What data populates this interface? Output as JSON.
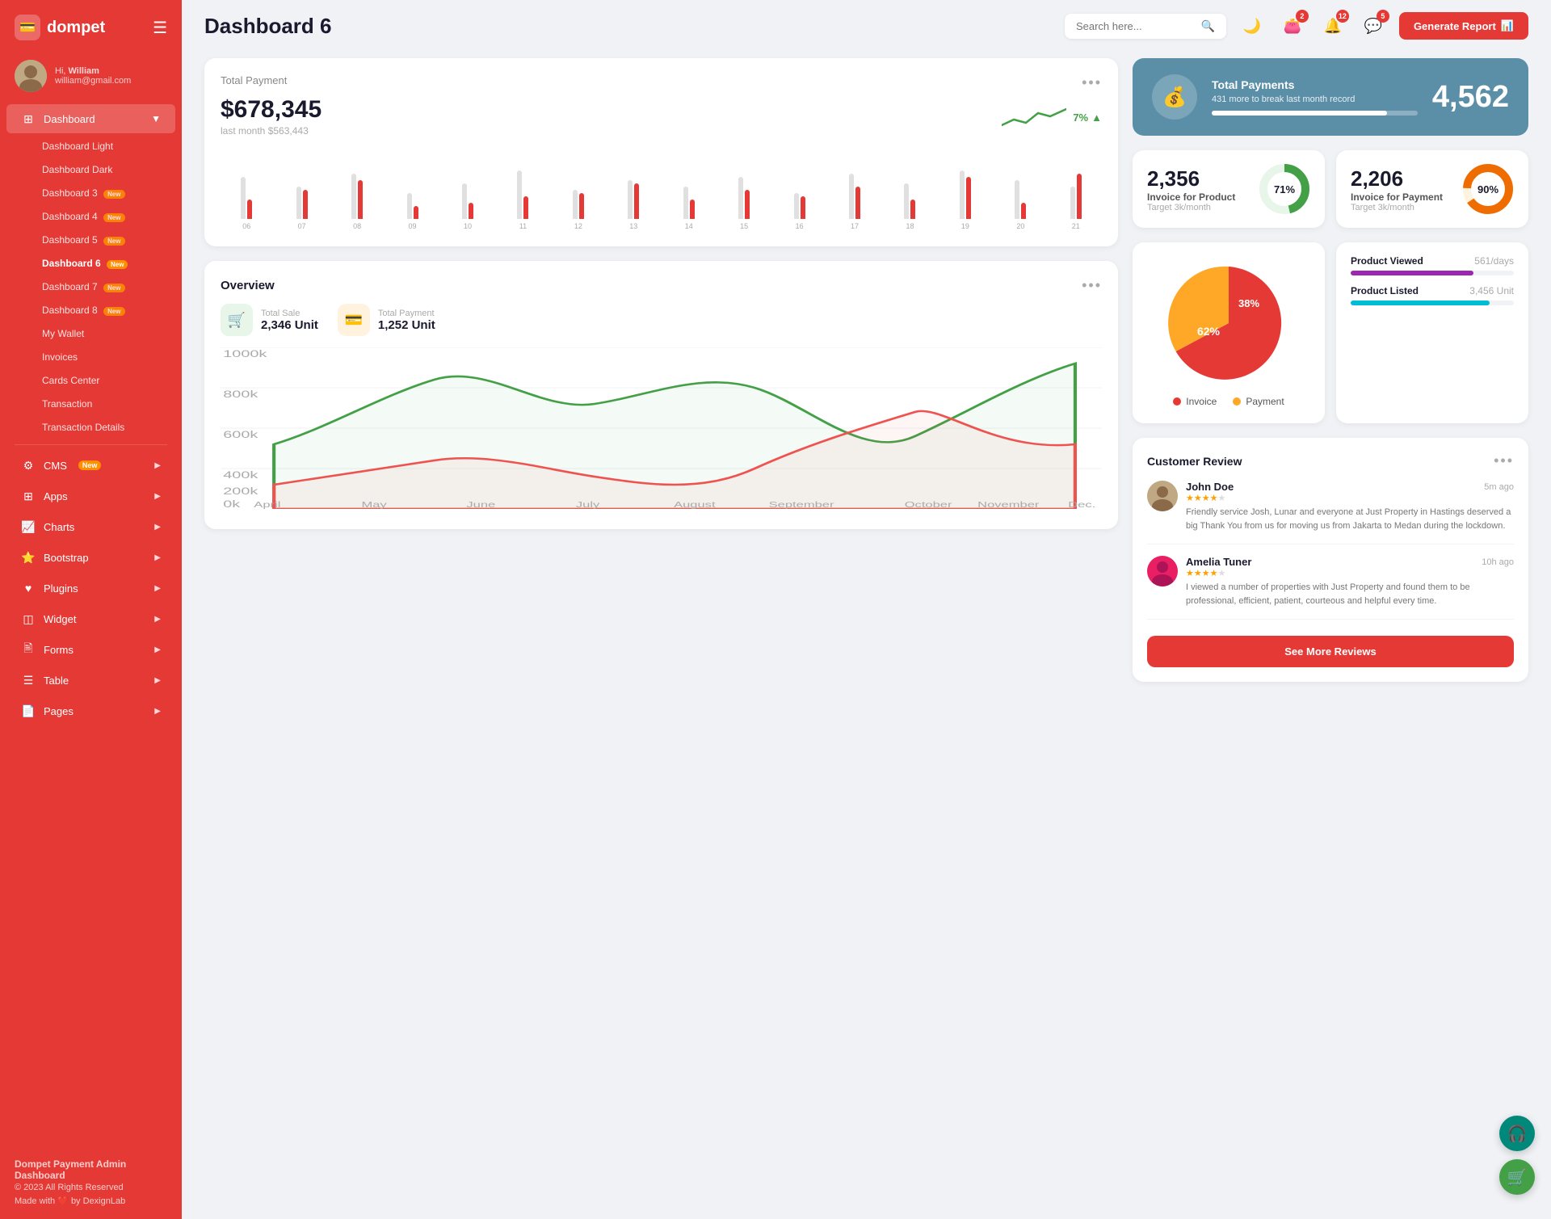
{
  "brand": {
    "name": "dompet",
    "logo_icon": "💳"
  },
  "user": {
    "greeting": "Hi,",
    "name": "William",
    "email": "william@gmail.com",
    "avatar_color": "#c0a882"
  },
  "page_title": "Dashboard 6",
  "search": {
    "placeholder": "Search here..."
  },
  "topbar": {
    "icons": {
      "dark_mode": "🌙",
      "wallet_badge": "2",
      "bell_badge": "12",
      "message_badge": "5"
    },
    "generate_btn": "Generate Report"
  },
  "sidebar": {
    "dashboard_section": {
      "label": "Dashboard",
      "items": [
        {
          "label": "Dashboard Light",
          "id": "dashboard-light",
          "badge": null
        },
        {
          "label": "Dashboard Dark",
          "id": "dashboard-dark",
          "badge": null
        },
        {
          "label": "Dashboard 3",
          "id": "dashboard-3",
          "badge": "New"
        },
        {
          "label": "Dashboard 4",
          "id": "dashboard-4",
          "badge": "New"
        },
        {
          "label": "Dashboard 5",
          "id": "dashboard-5",
          "badge": "New"
        },
        {
          "label": "Dashboard 6",
          "id": "dashboard-6",
          "badge": "New",
          "active": true
        },
        {
          "label": "Dashboard 7",
          "id": "dashboard-7",
          "badge": "New"
        },
        {
          "label": "Dashboard 8",
          "id": "dashboard-8",
          "badge": "New"
        },
        {
          "label": "My Wallet",
          "id": "my-wallet",
          "badge": null
        },
        {
          "label": "Invoices",
          "id": "invoices",
          "badge": null
        },
        {
          "label": "Cards Center",
          "id": "cards-center",
          "badge": null
        },
        {
          "label": "Transaction",
          "id": "transaction",
          "badge": null
        },
        {
          "label": "Transaction Details",
          "id": "transaction-details",
          "badge": null
        }
      ]
    },
    "menu_items": [
      {
        "label": "CMS",
        "id": "cms",
        "badge": "New",
        "has_arrow": true,
        "icon": "⚙️"
      },
      {
        "label": "Apps",
        "id": "apps",
        "has_arrow": true,
        "icon": "🔲"
      },
      {
        "label": "Charts",
        "id": "charts",
        "has_arrow": true,
        "icon": "📈"
      },
      {
        "label": "Bootstrap",
        "id": "bootstrap",
        "has_arrow": true,
        "icon": "⭐"
      },
      {
        "label": "Plugins",
        "id": "plugins",
        "has_arrow": true,
        "icon": "❤️"
      },
      {
        "label": "Widget",
        "id": "widget",
        "has_arrow": true,
        "icon": "🔲"
      },
      {
        "label": "Forms",
        "id": "forms",
        "has_arrow": true,
        "icon": "🖨️"
      },
      {
        "label": "Table",
        "id": "table",
        "has_arrow": true,
        "icon": "☰"
      },
      {
        "label": "Pages",
        "id": "pages",
        "has_arrow": true,
        "icon": "📄"
      }
    ],
    "footer": {
      "company": "Dompet Payment Admin Dashboard",
      "copyright": "© 2023 All Rights Reserved",
      "made_with": "Made with ❤️ by DexignLab"
    }
  },
  "total_payment": {
    "title": "Total Payment",
    "amount": "$678,345",
    "last_month_label": "last month $563,443",
    "trend_percent": "7%",
    "trend_direction": "up",
    "bars": [
      {
        "label": "06",
        "gray": 65,
        "red": 30
      },
      {
        "label": "07",
        "gray": 50,
        "red": 45
      },
      {
        "label": "08",
        "gray": 70,
        "red": 60
      },
      {
        "label": "09",
        "gray": 40,
        "red": 20
      },
      {
        "label": "10",
        "gray": 55,
        "red": 25
      },
      {
        "label": "11",
        "gray": 75,
        "red": 35
      },
      {
        "label": "12",
        "gray": 45,
        "red": 40
      },
      {
        "label": "13",
        "gray": 60,
        "red": 55
      },
      {
        "label": "14",
        "gray": 50,
        "red": 30
      },
      {
        "label": "15",
        "gray": 65,
        "red": 45
      },
      {
        "label": "16",
        "gray": 40,
        "red": 35
      },
      {
        "label": "17",
        "gray": 70,
        "red": 50
      },
      {
        "label": "18",
        "gray": 55,
        "red": 30
      },
      {
        "label": "19",
        "gray": 75,
        "red": 65
      },
      {
        "label": "20",
        "gray": 60,
        "red": 25
      },
      {
        "label": "21",
        "gray": 50,
        "red": 70
      }
    ]
  },
  "total_payments_banner": {
    "icon": "💰",
    "label": "Total Payments",
    "sub": "431 more to break last month record",
    "number": "4,562",
    "progress": 85
  },
  "invoice_product": {
    "value": "2,356",
    "label": "Invoice for Product",
    "target": "Target 3k/month",
    "percent": 71,
    "color": "#43a047"
  },
  "invoice_payment": {
    "value": "2,206",
    "label": "Invoice for Payment",
    "target": "Target 3k/month",
    "percent": 90,
    "color": "#ef6c00"
  },
  "overview": {
    "title": "Overview",
    "total_sale_label": "Total Sale",
    "total_sale_value": "2,346 Unit",
    "total_payment_label": "Total Payment",
    "total_payment_value": "1,252 Unit",
    "months": [
      "April",
      "May",
      "June",
      "July",
      "August",
      "September",
      "October",
      "November",
      "Dec."
    ]
  },
  "pie_chart": {
    "invoice_percent": 62,
    "payment_percent": 38,
    "invoice_label": "Invoice",
    "payment_label": "Payment",
    "invoice_color": "#e53935",
    "payment_color": "#ffa726"
  },
  "products": {
    "viewed_label": "Product Viewed",
    "viewed_value": "561/days",
    "viewed_color": "#9c27b0",
    "viewed_percent": 75,
    "listed_label": "Product Listed",
    "listed_value": "3,456 Unit",
    "listed_color": "#00bcd4",
    "listed_percent": 85
  },
  "customer_review": {
    "title": "Customer Review",
    "reviews": [
      {
        "name": "John Doe",
        "rating": 4,
        "time": "5m ago",
        "text": "Friendly service Josh, Lunar and everyone at Just Property in Hastings deserved a big Thank You from us for moving us from Jakarta to Medan during the lockdown.",
        "avatar_color": "#c0a882"
      },
      {
        "name": "Amelia Tuner",
        "rating": 4,
        "time": "10h ago",
        "text": "I viewed a number of properties with Just Property and found them to be professional, efficient, patient, courteous and helpful every time.",
        "avatar_color": "#e91e63"
      }
    ],
    "see_more_label": "See More Reviews"
  }
}
